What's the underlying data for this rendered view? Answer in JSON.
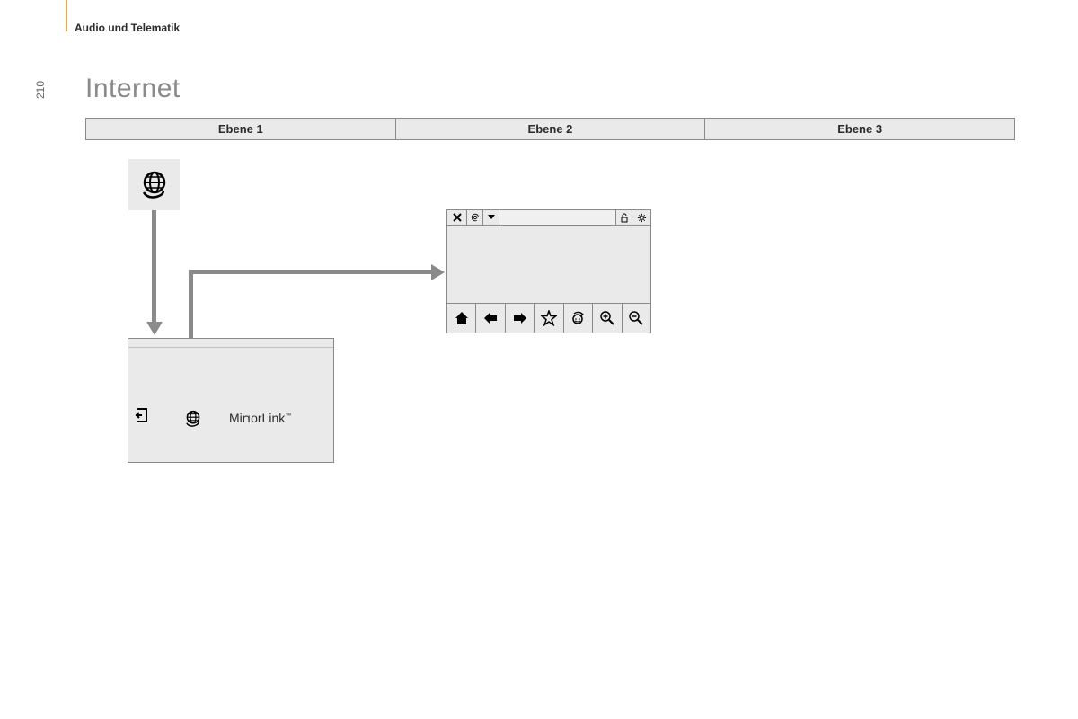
{
  "header": {
    "breadcrumb": "Audio und Telematik",
    "page_number": "210",
    "title": "Internet"
  },
  "levels": {
    "col1": "Ebene 1",
    "col2": "Ebene 2",
    "col3": "Ebene 3"
  },
  "menu_panel": {
    "mirrorlink_prefix": "Mir",
    "mirrorlink_r": "r",
    "mirrorlink_suffix": "orLink"
  },
  "icons": {
    "globe": "globe-hand-icon",
    "exit": "exit-icon",
    "close": "close-icon",
    "at": "at-icon",
    "dropdown": "chevron-down-icon",
    "lock": "unlock-icon",
    "settings": "gear-icon",
    "home": "home-icon",
    "back": "arrow-left-icon",
    "forward": "arrow-right-icon",
    "star": "star-icon",
    "refresh": "refresh-icon",
    "zoom_in": "zoom-in-icon",
    "zoom_out": "zoom-out-icon"
  }
}
